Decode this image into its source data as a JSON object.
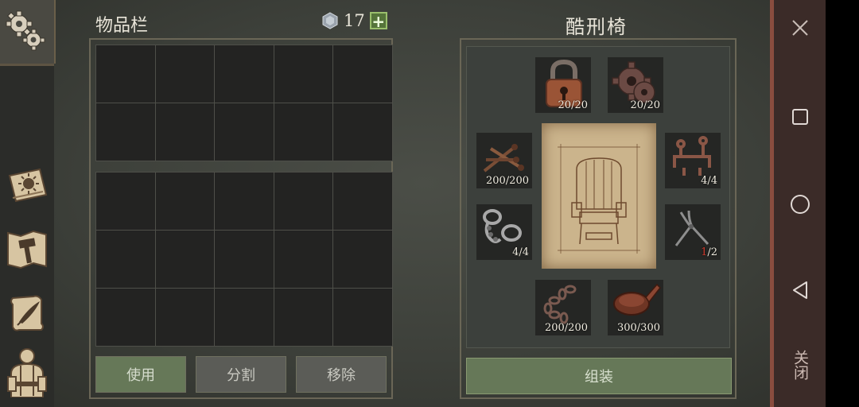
{
  "inventory": {
    "title": "物品栏",
    "gem_count": "17",
    "plus_label": "+",
    "buttons": {
      "use": "使用",
      "split": "分割",
      "remove": "移除"
    }
  },
  "crafting": {
    "title": "酷刑椅",
    "assemble_label": "组装",
    "slots": [
      {
        "name": "padlock",
        "count": "20/20"
      },
      {
        "name": "gear",
        "count": "20/20"
      },
      {
        "name": "nails",
        "count": "200/200"
      },
      {
        "name": "brackets",
        "count": "4/4"
      },
      {
        "name": "shackles",
        "count": "4/4"
      },
      {
        "name": "pliers",
        "have": "1",
        "need": "/2"
      },
      {
        "name": "chain",
        "count": "200/200"
      },
      {
        "name": "leather-strap",
        "count": "300/300"
      }
    ]
  },
  "nav": {
    "close_label": "关闭"
  },
  "colors": {
    "accent_green": "#667858",
    "missing_red": "#d23b2e",
    "nav_bg": "#3b2b28"
  }
}
